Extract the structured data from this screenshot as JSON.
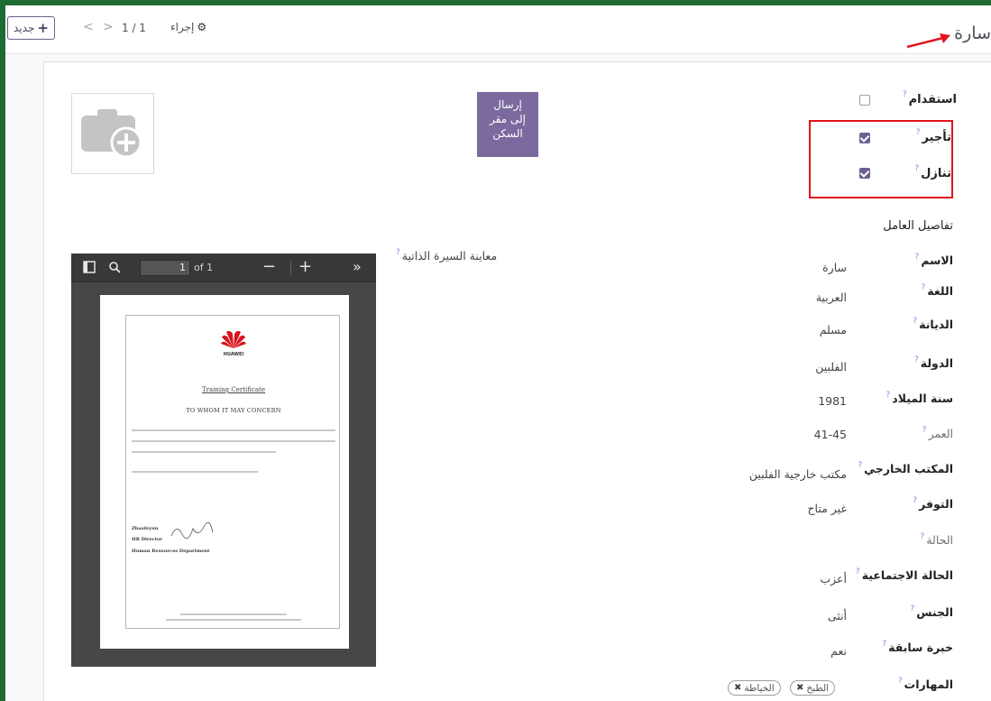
{
  "control_panel": {
    "breadcrumb": "سارة",
    "new_button": "جديد",
    "pager_value": "1 / 1",
    "action_label": "إجراء"
  },
  "header": {
    "send_button": [
      "إرسال",
      "إلى مقر",
      "السكن"
    ]
  },
  "top_fields": [
    {
      "label": "استقدام",
      "checked": false
    },
    {
      "label": "تأجير",
      "checked": true
    },
    {
      "label": "تنازل",
      "checked": true
    }
  ],
  "section_title": "تفاصيل العامل",
  "fields": [
    {
      "label": "الاسم",
      "value": "سارة"
    },
    {
      "label": "اللغة",
      "value": "العربية"
    },
    {
      "label": "الديانة",
      "value": "مسلم"
    },
    {
      "label": "الدولة",
      "value": "الفلبين"
    },
    {
      "label": "سنة الميلاد",
      "value": "1981"
    },
    {
      "label": "العمر",
      "value": "41-45"
    },
    {
      "label": "المكتب الخارجي",
      "value": "مكتب خارجية الفلبين"
    },
    {
      "label": "التوفر",
      "value": "غير متاح"
    },
    {
      "label": "الحالة",
      "value": ""
    },
    {
      "label": "الحالة الاجتماعية",
      "value": "أعزب"
    },
    {
      "label": "الجنس",
      "value": "أنثى"
    },
    {
      "label": "خبرة سابقة",
      "value": "نعم"
    },
    {
      "label": "المهارات",
      "value": ""
    }
  ],
  "skills": [
    "الطبخ",
    "الخياطة"
  ],
  "cv": {
    "label": "معاينة السيرة الذاتية",
    "page_number": "1",
    "page_of": "of 1",
    "brand": "HUAWEI",
    "certificate_title": "Training Certificate",
    "concern_line": "TO WHOM IT MAY CONCERN",
    "signer_name": "Zhaofeyun",
    "signer_title": "HR Director",
    "signer_dept": "Human Resources Department"
  },
  "colors": {
    "frame": "#1f6b34",
    "primary": "#7b6a9e",
    "checkbox": "#6f5f92",
    "highlight": "#e0141e",
    "help": "#7e8be0"
  }
}
